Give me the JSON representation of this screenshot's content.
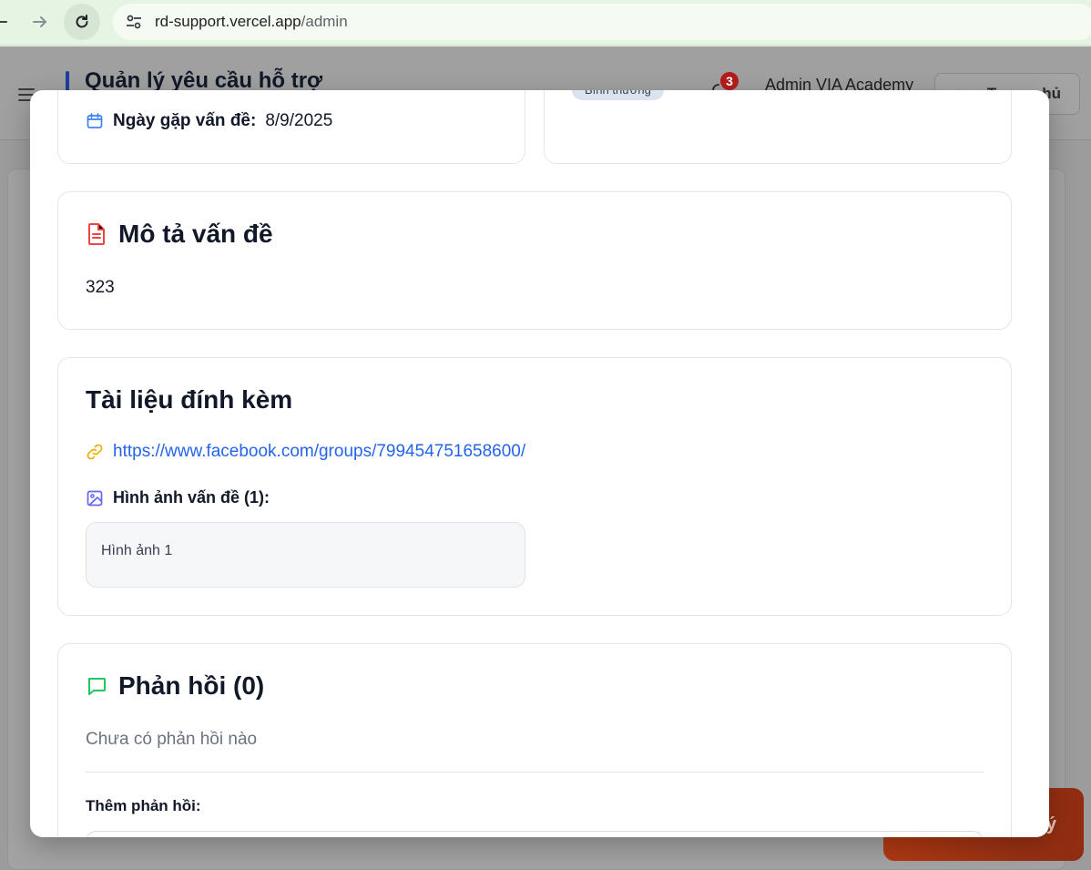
{
  "browser": {
    "url_host": "rd-support.vercel.app",
    "url_path": "/admin"
  },
  "app": {
    "title": "Quản lý yêu cầu hỗ trợ",
    "notification_count": "3",
    "admin_name": "Admin VIA Academy",
    "home_button": "Trang chủ",
    "orange_button": "Xử lý"
  },
  "modal": {
    "priority_badge": "Bình thường",
    "date_label": "Ngày gặp vấn đề:",
    "date_value": "8/9/2025",
    "description": {
      "heading": "Mô tả vấn đề",
      "text": "323"
    },
    "attachments": {
      "heading": "Tài liệu đính kèm",
      "link": "https://www.facebook.com/groups/799454751658600/",
      "images_label": "Hình ảnh vấn đề (1):",
      "image_item": "Hình ảnh 1"
    },
    "replies": {
      "heading": "Phản hồi (0)",
      "empty_text": "Chưa có phản hồi nào",
      "add_label": "Thêm phản hồi:"
    }
  },
  "colors": {
    "link": "#2563eb",
    "file_icon": "#ef4444",
    "chat_icon": "#22c55e",
    "link_icon": "#eab308",
    "image_icon": "#6366f1",
    "calendar_icon": "#3b82f6"
  }
}
